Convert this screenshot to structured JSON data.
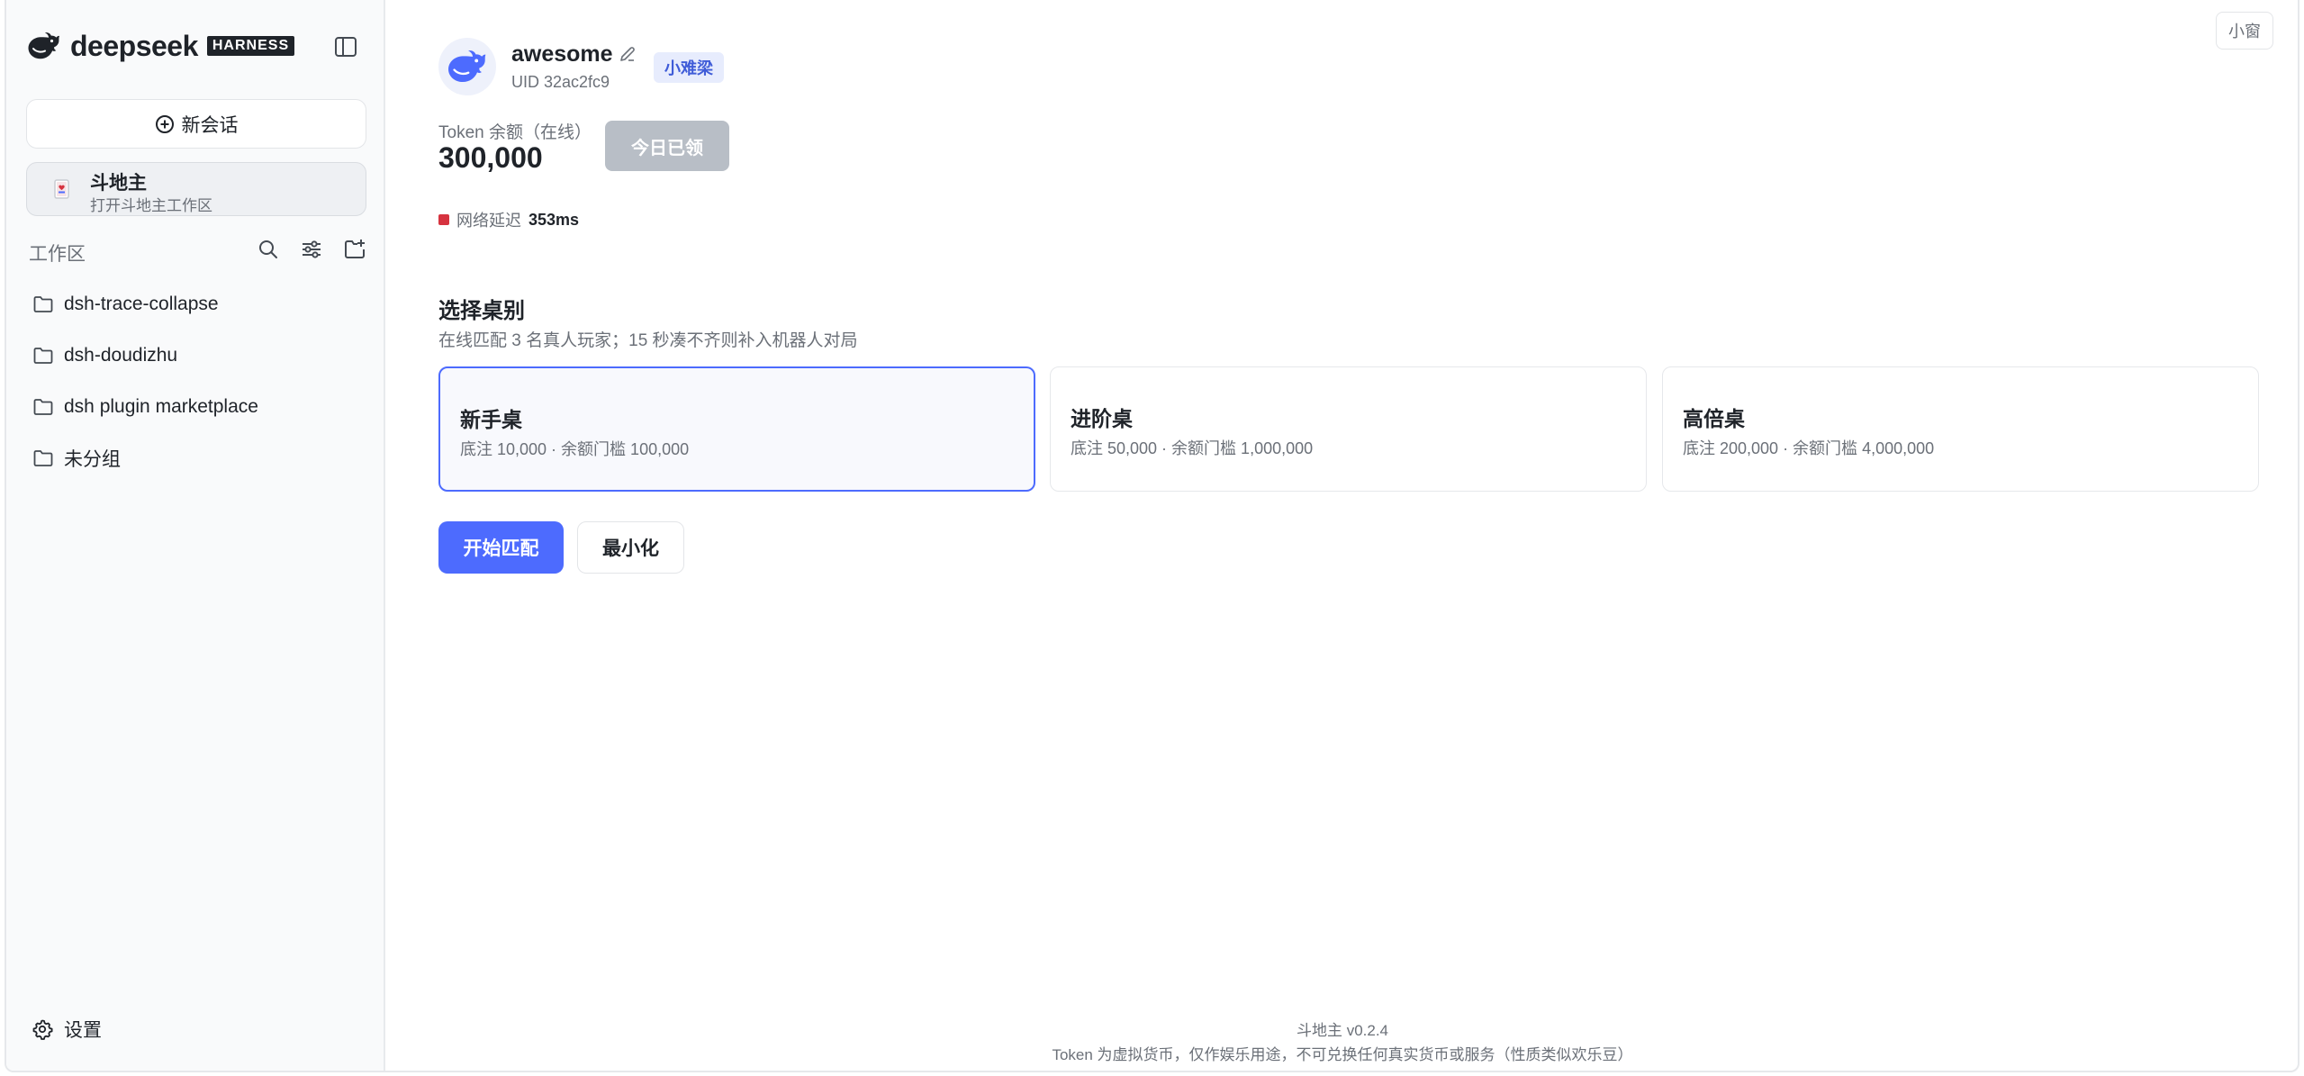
{
  "sidebar": {
    "brand": {
      "name": "deepseek",
      "badge": "HARNESS"
    },
    "new_chat_label": "新会话",
    "game_entry": {
      "title": "斗地主",
      "subtitle": "打开斗地主工作区"
    },
    "workspace_label": "工作区",
    "folders": [
      {
        "label": "dsh-trace-collapse"
      },
      {
        "label": "dsh-doudizhu"
      },
      {
        "label": "dsh plugin marketplace"
      },
      {
        "label": "未分组"
      }
    ],
    "settings_label": "设置"
  },
  "header": {
    "mini_window_label": "小窗"
  },
  "profile": {
    "username": "awesome",
    "tag": "小难梁",
    "uid": "UID 32ac2fc9",
    "token_label": "Token 余额（在线）",
    "token_value": "300,000",
    "claim_button": "今日已领",
    "latency_label": "网络延迟",
    "latency_value": "353ms"
  },
  "table_select": {
    "title": "选择桌别",
    "subtitle": "在线匹配 3 名真人玩家；15 秒凑不齐则补入机器人对局",
    "tables": [
      {
        "name": "新手桌",
        "desc": "底注 10,000 · 余额门槛 100,000",
        "selected": true
      },
      {
        "name": "进阶桌",
        "desc": "底注 50,000 · 余额门槛 1,000,000",
        "selected": false
      },
      {
        "name": "高倍桌",
        "desc": "底注 200,000 · 余额门槛 4,000,000",
        "selected": false
      }
    ],
    "start_button": "开始匹配",
    "minimize_button": "最小化"
  },
  "footer": {
    "version": "斗地主 v0.2.4",
    "disclaimer": "Token 为虚拟货币，仅作娱乐用途，不可兑换任何真实货币或服务（性质类似欢乐豆）"
  },
  "colors": {
    "accent": "#4d6bfe",
    "tag_bg": "#e7ecfd",
    "latency_indicator": "#d6333f",
    "disabled_button": "#b8bec6"
  },
  "icons": [
    "deepseek-whale-logo",
    "sidebar-toggle-icon",
    "plus-circle-icon",
    "playing-card-icon",
    "search-icon",
    "sliders-icon",
    "new-folder-icon",
    "folder-icon",
    "gear-icon",
    "pencil-icon"
  ]
}
